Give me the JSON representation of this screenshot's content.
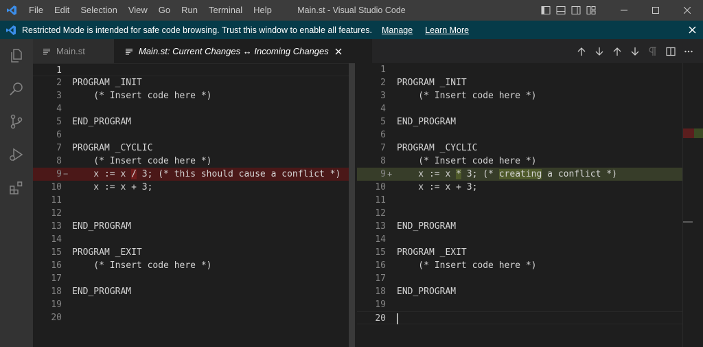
{
  "titlebar": {
    "menu": [
      "File",
      "Edit",
      "Selection",
      "View",
      "Go",
      "Run",
      "Terminal",
      "Help"
    ],
    "window_title": "Main.st - Visual Studio Code"
  },
  "banner": {
    "message": "Restricted Mode is intended for safe code browsing. Trust this window to enable all features.",
    "manage_label": "Manage",
    "learn_more_label": "Learn More"
  },
  "tabs": [
    {
      "label": "Main.st",
      "active": false
    },
    {
      "label": "Main.st: Current Changes ↔ Incoming Changes",
      "active": true
    }
  ],
  "left_editor": {
    "lines": [
      {
        "n": "1",
        "code": ""
      },
      {
        "n": "2",
        "code": "PROGRAM _INIT"
      },
      {
        "n": "3",
        "code": "    (* Insert code here *)"
      },
      {
        "n": "4",
        "code": ""
      },
      {
        "n": "5",
        "code": "END_PROGRAM"
      },
      {
        "n": "6",
        "code": ""
      },
      {
        "n": "7",
        "code": "PROGRAM _CYCLIC"
      },
      {
        "n": "8",
        "code": "    (* Insert code here *)"
      },
      {
        "n": "9",
        "marker": "−",
        "code_pre": "    x := x ",
        "code_word": "/",
        "code_post": " 3; (* this should cause a conflict *)"
      },
      {
        "n": "10",
        "code": "    x := x + 3;"
      },
      {
        "n": "11",
        "code": ""
      },
      {
        "n": "12",
        "code": ""
      },
      {
        "n": "13",
        "code": "END_PROGRAM"
      },
      {
        "n": "14",
        "code": ""
      },
      {
        "n": "15",
        "code": "PROGRAM _EXIT"
      },
      {
        "n": "16",
        "code": "    (* Insert code here *)"
      },
      {
        "n": "17",
        "code": ""
      },
      {
        "n": "18",
        "code": "END_PROGRAM"
      },
      {
        "n": "19",
        "code": ""
      },
      {
        "n": "20",
        "code": ""
      }
    ]
  },
  "right_editor": {
    "lines": [
      {
        "n": "1",
        "code": ""
      },
      {
        "n": "2",
        "code": "PROGRAM _INIT"
      },
      {
        "n": "3",
        "code": "    (* Insert code here *)"
      },
      {
        "n": "4",
        "code": ""
      },
      {
        "n": "5",
        "code": "END_PROGRAM"
      },
      {
        "n": "6",
        "code": ""
      },
      {
        "n": "7",
        "code": "PROGRAM _CYCLIC"
      },
      {
        "n": "8",
        "code": "    (* Insert code here *)"
      },
      {
        "n": "9",
        "marker": "+",
        "code_pre": "    x := x ",
        "code_word": "*",
        "code_mid": " 3; (* ",
        "code_word2": "creating",
        "code_post": " a conflict *)"
      },
      {
        "n": "10",
        "code": "    x := x + 3;"
      },
      {
        "n": "11",
        "code": ""
      },
      {
        "n": "12",
        "code": ""
      },
      {
        "n": "13",
        "code": "END_PROGRAM"
      },
      {
        "n": "14",
        "code": ""
      },
      {
        "n": "15",
        "code": "PROGRAM _EXIT"
      },
      {
        "n": "16",
        "code": "    (* Insert code here *)"
      },
      {
        "n": "17",
        "code": ""
      },
      {
        "n": "18",
        "code": "END_PROGRAM"
      },
      {
        "n": "19",
        "code": ""
      },
      {
        "n": "20",
        "code": ""
      }
    ]
  },
  "colors": {
    "titlebar": "#3c3c3c",
    "banner": "#063b49",
    "activitybar": "#333333",
    "editor_bg": "#1e1e1e",
    "deleted_line": "#4b1818",
    "inserted_line": "#373d29",
    "vscode_blue": "#3b8eea"
  }
}
